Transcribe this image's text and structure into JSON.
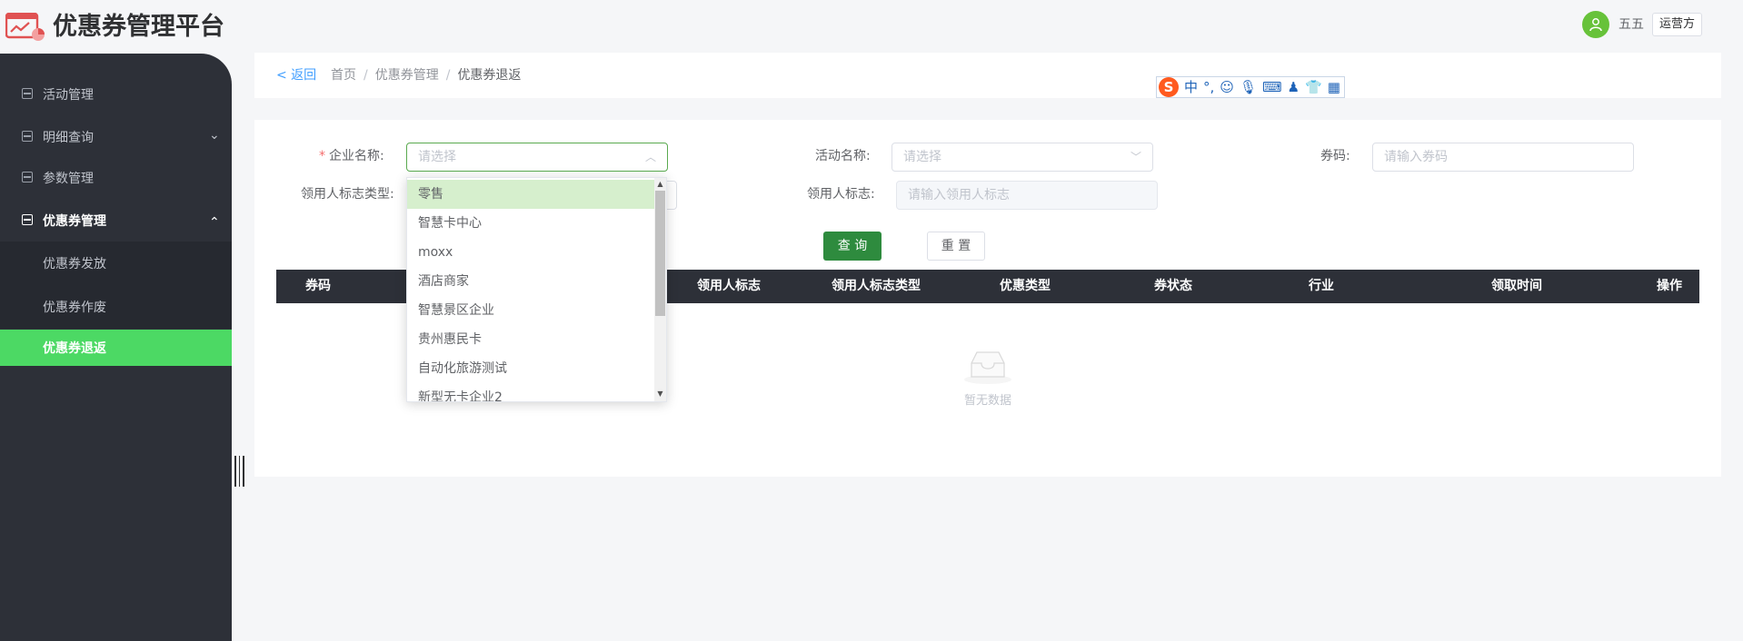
{
  "header": {
    "title": "优惠券管理平台",
    "user_name": "五五",
    "role_tag": "运营方"
  },
  "sidebar": {
    "items": [
      {
        "label": "活动管理"
      },
      {
        "label": "明细查询",
        "chevron": "⌄"
      },
      {
        "label": "参数管理"
      },
      {
        "label": "优惠券管理",
        "chevron": "⌃"
      }
    ],
    "sub_items": [
      {
        "label": "优惠券发放"
      },
      {
        "label": "优惠券作废"
      },
      {
        "label": "优惠券退返"
      }
    ]
  },
  "breadcrumb": {
    "back": "< 返回",
    "items": [
      "首页",
      "优惠券管理",
      "优惠券退返"
    ],
    "separator": "/"
  },
  "ime": {
    "logo": "S",
    "items": [
      "中",
      "°,",
      "☺",
      "🎙",
      "⌨",
      "♟",
      "👕",
      "▦"
    ]
  },
  "form": {
    "enterprise_label": "企业名称:",
    "enterprise_required": "*",
    "enterprise_placeholder": "请选择",
    "activity_label": "活动名称:",
    "activity_placeholder": "请选择",
    "code_label": "券码:",
    "code_placeholder": "请输入券码",
    "flag_type_label": "领用人标志类型:",
    "flag_label": "领用人标志:",
    "flag_placeholder": "请输入领用人标志",
    "query_button": "查 询",
    "reset_button": "重 置"
  },
  "table": {
    "columns": [
      "券码",
      "领用人标志",
      "领用人标志类型",
      "优惠类型",
      "券状态",
      "行业",
      "领取时间",
      "操作"
    ],
    "empty_text": "暂无数据"
  },
  "dropdown": {
    "options": [
      "零售",
      "智慧卡中心",
      "moxx",
      "酒店商家",
      "智慧景区企业",
      "贵州惠民卡",
      "自动化旅游测试",
      "新型无卡企业2"
    ],
    "hover_index": 0
  },
  "colors": {
    "accent_green": "#4cd964",
    "sidebar_bg": "#2d3038",
    "query_green": "#2e8b3e",
    "link_blue": "#409eff",
    "required_red": "#f56c6c"
  }
}
